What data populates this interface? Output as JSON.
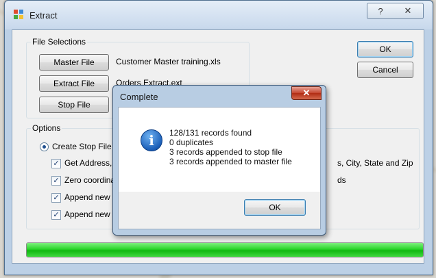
{
  "window": {
    "title": "Extract",
    "help_glyph": "?",
    "close_glyph": "✕"
  },
  "file_selections": {
    "legend": "File Selections",
    "master_button": "Master File",
    "master_value": "Customer Master training.xls",
    "extract_button": "Extract File",
    "extract_value": "Orders Extract.ext",
    "stop_button": "Stop File"
  },
  "actions": {
    "ok_label": "OK",
    "cancel_label": "Cancel"
  },
  "options": {
    "legend": "Options",
    "create_stop_file": "Create Stop File",
    "checks": [
      {
        "label": "Get Address, C",
        "checked": true
      },
      {
        "label": "Zero coordinat",
        "checked": true
      },
      {
        "label": "Append new a",
        "checked": true
      },
      {
        "label": "Append new a",
        "checked": true
      }
    ],
    "right_fragments": [
      "s, City, State and Zip",
      "ds"
    ]
  },
  "progress": {
    "percent": 100,
    "color": "#22cc22"
  },
  "dialog": {
    "title": "Complete",
    "close_glyph": "✕",
    "icon": "info-icon",
    "lines": [
      "128/131 records found",
      "0 duplicates",
      "3 records appended to stop file",
      "3 records appended to master file"
    ],
    "ok_label": "OK"
  }
}
